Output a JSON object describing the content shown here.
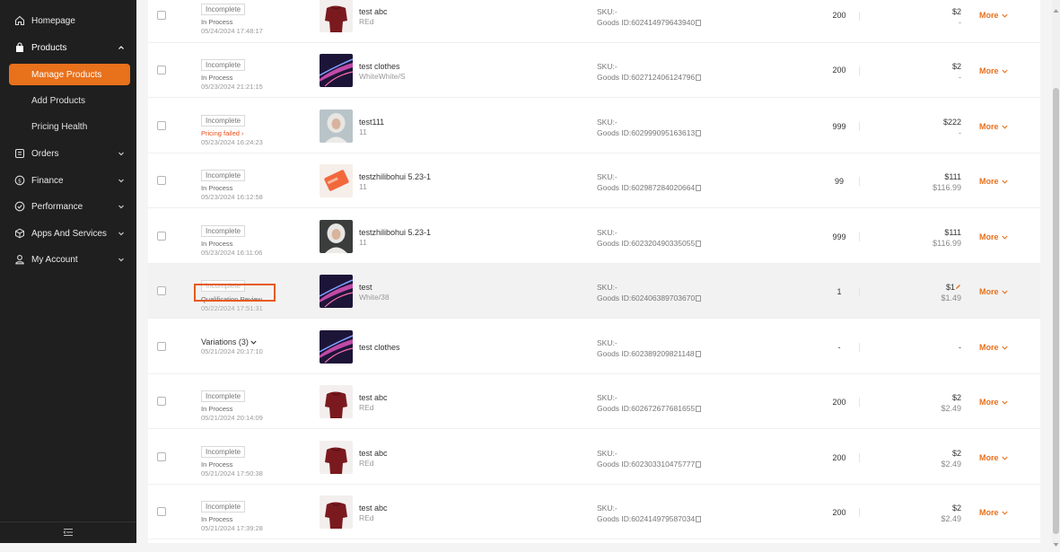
{
  "sidebar": {
    "items": [
      {
        "label": "Homepage",
        "icon": "home-icon"
      },
      {
        "label": "Products",
        "icon": "bag-icon"
      },
      {
        "label": "Manage Products"
      },
      {
        "label": "Add Products"
      },
      {
        "label": "Pricing Health"
      },
      {
        "label": "Orders",
        "icon": "orders-icon"
      },
      {
        "label": "Finance",
        "icon": "dollar-icon"
      },
      {
        "label": "Performance",
        "icon": "gauge-icon"
      },
      {
        "label": "Apps And Services",
        "icon": "cube-icon"
      },
      {
        "label": "My Account",
        "icon": "user-icon"
      }
    ],
    "footer_icon": "collapse-menu-icon"
  },
  "colors": {
    "accent": "#e8711c",
    "sidebar_bg": "#1f1f1f",
    "highlight": "#e65a1c"
  },
  "rows": [
    {
      "status": "Incomplete",
      "sub_status": "In Process",
      "date": "05/24/2024 17:48:17",
      "name": "test abc",
      "variant": "REd",
      "sku": "SKU:-",
      "goods_id": "Goods ID:602414979643940",
      "qty": "200",
      "price": "$2",
      "price2": "-",
      "more": "More"
    },
    {
      "status": "Incomplete",
      "sub_status": "In Process",
      "date": "05/23/2024 21:21:15",
      "name": "test clothes",
      "variant": "WhiteWhite/S",
      "sku": "SKU:-",
      "goods_id": "Goods ID:602712406124796",
      "qty": "200",
      "price": "$2",
      "price2": "-",
      "more": "More"
    },
    {
      "status": "Incomplete",
      "sub_status": "Pricing failed",
      "date": "05/23/2024 16:24:23",
      "name": "test111",
      "variant": "11",
      "sku": "SKU:-",
      "goods_id": "Goods ID:602999095163613",
      "qty": "999",
      "price": "$222",
      "price2": "-",
      "more": "More"
    },
    {
      "status": "Incomplete",
      "sub_status": "In Process",
      "date": "05/23/2024 16:12:58",
      "name": "testzhilibohui 5.23-1",
      "variant": "11",
      "sku": "SKU:-",
      "goods_id": "Goods ID:602987284020664",
      "qty": "99",
      "price": "$111",
      "price2": "$116.99",
      "more": "More"
    },
    {
      "status": "Incomplete",
      "sub_status": "In Process",
      "date": "05/23/2024 16:11:06",
      "name": "testzhilibohui 5.23-1",
      "variant": "11",
      "sku": "SKU:-",
      "goods_id": "Goods ID:602320490335055",
      "qty": "999",
      "price": "$111",
      "price2": "$116.99",
      "more": "More"
    },
    {
      "status": "Incomplete",
      "sub_status": "Qualification Review",
      "date": "05/22/2024 17:51:31",
      "name": "test",
      "variant": "White/38",
      "sku": "SKU:-",
      "goods_id": "Goods ID:602406389703670",
      "qty": "1",
      "price": "$1",
      "price2": "$1.49",
      "more": "More"
    },
    {
      "variations": "Variations (3)",
      "date": "05/21/2024 20:17:10",
      "name": "test clothes",
      "variant": "",
      "sku": "SKU:-",
      "goods_id": "Goods ID:602389209821148",
      "qty": "-",
      "price": "-",
      "price2": "",
      "more": "More"
    },
    {
      "status": "Incomplete",
      "sub_status": "In Process",
      "date": "05/21/2024 20:14:09",
      "name": "test abc",
      "variant": "REd",
      "sku": "SKU:-",
      "goods_id": "Goods ID:602672677681655",
      "qty": "200",
      "price": "$2",
      "price2": "$2.49",
      "more": "More"
    },
    {
      "status": "Incomplete",
      "sub_status": "In Process",
      "date": "05/21/2024 17:50:38",
      "name": "test abc",
      "variant": "REd",
      "sku": "SKU:-",
      "goods_id": "Goods ID:602303310475777",
      "qty": "200",
      "price": "$2",
      "price2": "$2.49",
      "more": "More"
    },
    {
      "status": "Incomplete",
      "sub_status": "In Process",
      "date": "05/21/2024 17:39:28",
      "name": "test abc",
      "variant": "REd",
      "sku": "SKU:-",
      "goods_id": "Goods ID:602414979587034",
      "qty": "200",
      "price": "$2",
      "price2": "$2.49",
      "more": "More"
    }
  ]
}
